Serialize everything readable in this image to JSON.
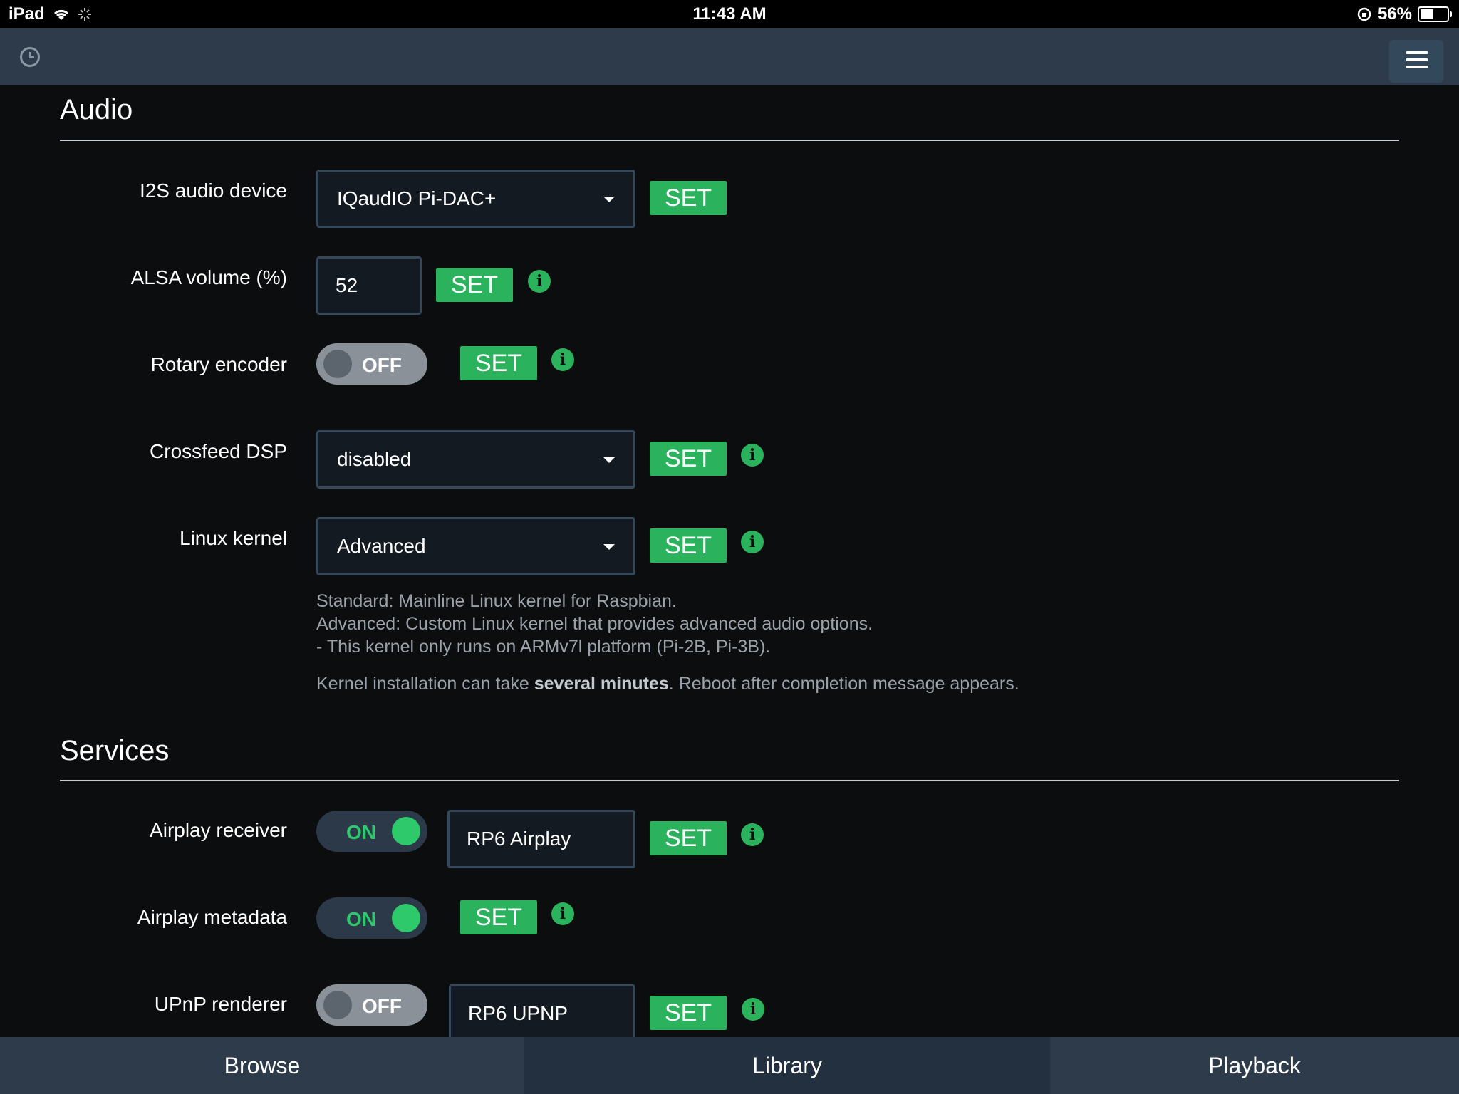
{
  "status_bar": {
    "device": "iPad",
    "time": "11:43 AM",
    "battery": "56%"
  },
  "audio": {
    "title": "Audio",
    "i2s": {
      "label": "I2S audio device",
      "value": "IQaudIO Pi-DAC+",
      "set": "SET"
    },
    "alsa": {
      "label": "ALSA volume (%)",
      "value": "52",
      "set": "SET"
    },
    "rotary": {
      "label": "Rotary encoder",
      "state": "OFF",
      "set": "SET"
    },
    "crossfeed": {
      "label": "Crossfeed DSP",
      "value": "disabled",
      "set": "SET"
    },
    "kernel": {
      "label": "Linux kernel",
      "value": "Advanced",
      "set": "SET",
      "help_line1": "Standard: Mainline Linux kernel for Raspbian.",
      "help_line2": "Advanced: Custom Linux kernel that provides advanced audio options.",
      "help_line3": "- This kernel only runs on ARMv7l platform (Pi-2B, Pi-3B).",
      "help_note_a": "Kernel installation can take ",
      "help_note_bold": "several minutes",
      "help_note_b": ". Reboot after completion message appears."
    }
  },
  "services": {
    "title": "Services",
    "airplay": {
      "label": "Airplay receiver",
      "state": "ON",
      "name": "RP6 Airplay",
      "set": "SET"
    },
    "airplay_meta": {
      "label": "Airplay metadata",
      "state": "ON",
      "set": "SET"
    },
    "upnp": {
      "label": "UPnP renderer",
      "state": "OFF",
      "name": "RP6 UPNP",
      "set": "SET"
    }
  },
  "tabs": {
    "browse": "Browse",
    "library": "Library",
    "playback": "Playback"
  },
  "colors": {
    "accent": "#2ab25d",
    "nav": "#2d3b4a",
    "background": "#0c0d0e"
  },
  "battery_level": 0.56
}
